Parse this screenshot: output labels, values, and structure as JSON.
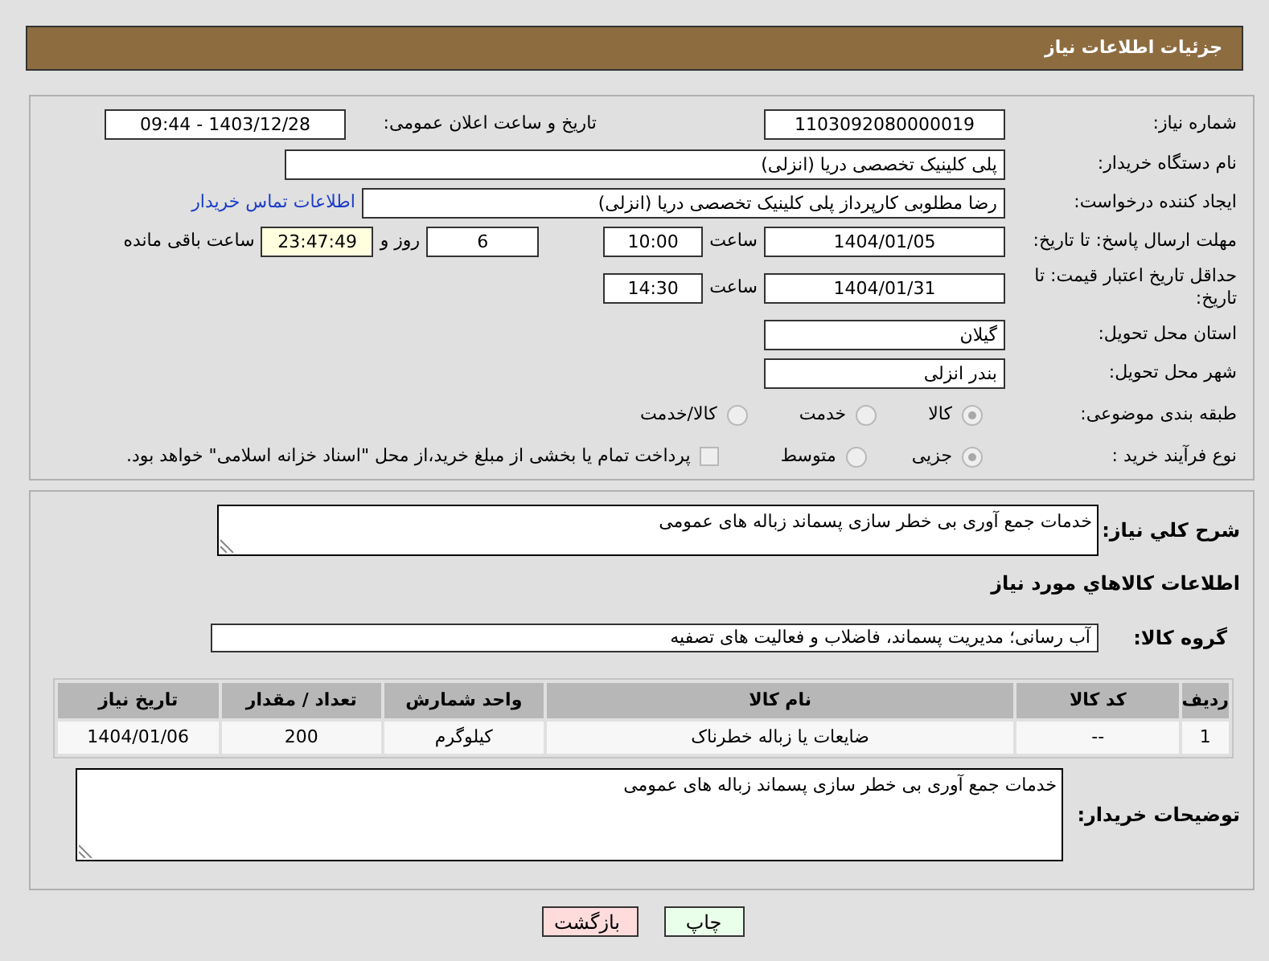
{
  "header": {
    "title": "جزئیات اطلاعات نیاز"
  },
  "need_number": {
    "label": "شماره نیاز:",
    "value": "1103092080000019"
  },
  "announce": {
    "label": "تاریخ و ساعت اعلان عمومی:",
    "value": "1403/12/28 - 09:44"
  },
  "buyer_org": {
    "label": "نام دستگاه خریدار:",
    "value": "پلی کلینیک تخصصی دریا (انزلی)"
  },
  "requester": {
    "label": "ایجاد کننده درخواست:",
    "value": "رضا مطلوبی کارپرداز پلی کلینیک تخصصی دریا (انزلی)",
    "link": "اطلاعات تماس خریدار"
  },
  "reply_deadline": {
    "label": "مهلت ارسال پاسخ: تا تاریخ:",
    "date": "1404/01/05",
    "time_label": "ساعت",
    "time": "10:00",
    "days": "6",
    "days_label": "روز و",
    "remaining": "23:47:49",
    "remaining_label": "ساعت باقی مانده"
  },
  "price_validity": {
    "label": "حداقل تاریخ اعتبار قیمت: تا تاریخ:",
    "date": "1404/01/31",
    "time_label": "ساعت",
    "time": "14:30"
  },
  "province": {
    "label": "استان محل تحویل:",
    "value": "گیلان"
  },
  "city": {
    "label": "شهر محل تحویل:",
    "value": "بندر انزلی"
  },
  "category": {
    "label": "طبقه بندی موضوعی:",
    "options": [
      {
        "label": "کالا",
        "selected": true
      },
      {
        "label": "خدمت",
        "selected": false
      },
      {
        "label": "کالا/خدمت",
        "selected": false
      }
    ]
  },
  "purchase_type": {
    "label": "نوع فرآیند خرید :",
    "options": [
      {
        "label": "جزیی",
        "selected": true
      },
      {
        "label": "متوسط",
        "selected": false
      }
    ],
    "treasury": {
      "label": "پرداخت تمام یا بخشی از مبلغ خرید،از محل \"اسناد خزانه اسلامی\" خواهد بود.",
      "checked": false
    }
  },
  "summary": {
    "label": "شرح کلي نياز:",
    "value": "خدمات جمع آوری بی خطر سازی پسماند زباله های عمومی"
  },
  "goods_heading": "اطلاعات كالاهاي مورد نياز",
  "goods_group": {
    "label": "گروه کالا:",
    "value": "آب رسانی؛ مدیریت پسماند، فاضلاب و فعالیت های تصفیه"
  },
  "table": {
    "columns": [
      "ردیف",
      "کد کالا",
      "نام کالا",
      "واحد شمارش",
      "تعداد / مقدار",
      "تاریخ نیاز"
    ],
    "rows": [
      [
        "1",
        "--",
        "ضایعات یا زباله خطرناک",
        "کیلوگرم",
        "200",
        "1404/01/06"
      ]
    ]
  },
  "buyer_notes": {
    "label": "توضیحات خریدار:",
    "value": "خدمات جمع آوری بی خطر سازی پسماند زباله های عمومی"
  },
  "buttons": [
    {
      "label": "چاپ",
      "kind": "print"
    },
    {
      "label": "بازگشت",
      "kind": "back"
    }
  ]
}
